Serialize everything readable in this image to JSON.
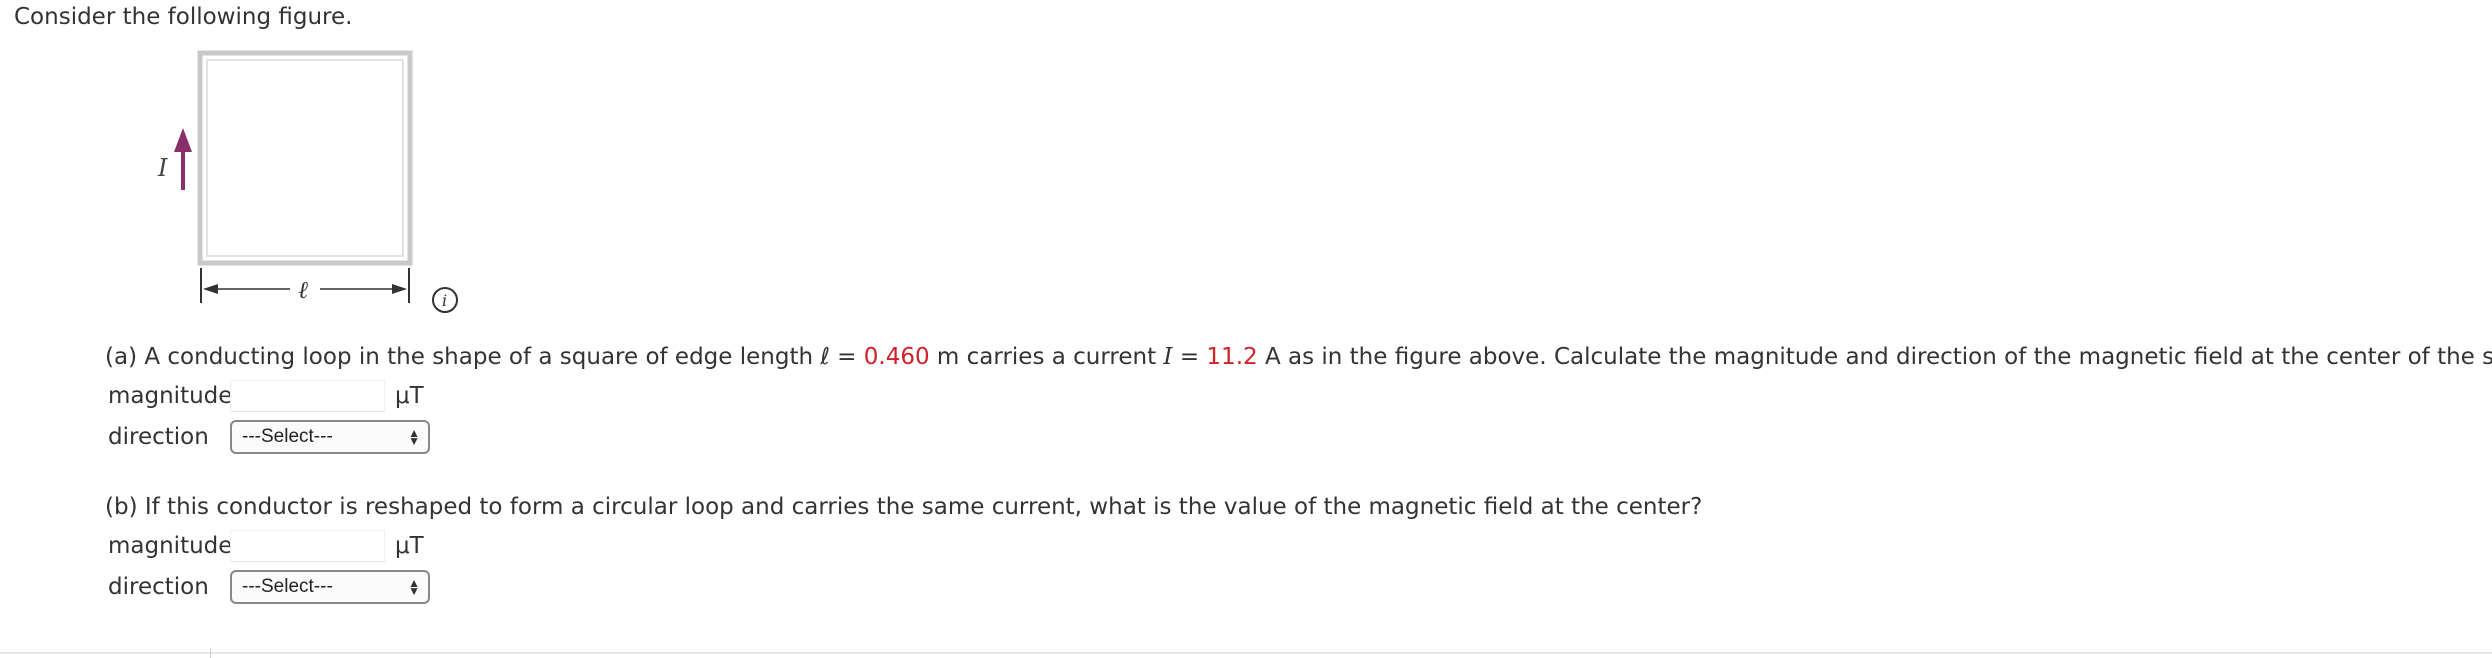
{
  "intro": "Consider the following figure.",
  "figure": {
    "current_label": "I",
    "length_label": "ℓ",
    "colors": {
      "loop": "#c8c8c8",
      "current_arrow": "#8b2f68",
      "dimension": "#333333"
    },
    "info_icon": "info-circle-icon"
  },
  "part_a": {
    "prefix": "(a) A conducting loop in the shape of a square of edge length ℓ = ",
    "length_value": "0.460",
    "mid1": " m carries a current ",
    "current_symbol": "I",
    "mid2": " = ",
    "current_value": "11.2",
    "suffix": " A as in the figure above. Calculate the magnitude and direction of the magnetic field at the center of the square.",
    "magnitude_label": "magnitude",
    "magnitude_value": "",
    "unit": "μT",
    "direction_label": "direction",
    "direction_selected": "---Select---"
  },
  "part_b": {
    "prompt": "(b) If this conductor is reshaped to form a circular loop and carries the same current, what is the value of the magnetic field at the center?",
    "magnitude_label": "magnitude",
    "magnitude_value": "",
    "unit": "μT",
    "direction_label": "direction",
    "direction_selected": "---Select---"
  },
  "colors": {
    "given_value": "#d0202a"
  }
}
